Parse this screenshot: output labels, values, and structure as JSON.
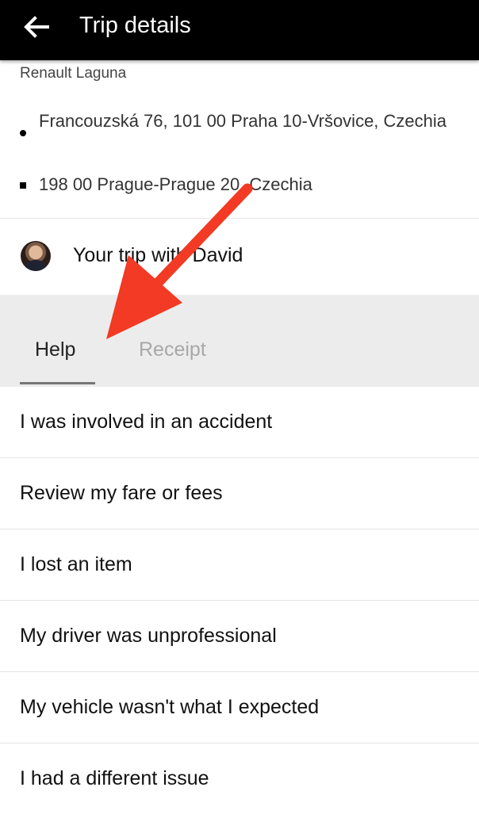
{
  "header": {
    "title": "Trip details",
    "back_icon": "back-arrow-icon"
  },
  "trip": {
    "vehicle": "Renault Laguna",
    "pickup": "Francouzská 76, 101 00 Praha 10-Vršovice, Czechia",
    "dropoff": "198 00 Prague-Prague 20, Czechia",
    "driver_label": "Your trip with David"
  },
  "tabs": [
    {
      "label": "Help",
      "active": true
    },
    {
      "label": "Receipt",
      "active": false
    }
  ],
  "help_items": [
    {
      "label": "I was involved in an accident"
    },
    {
      "label": "Review my fare or fees"
    },
    {
      "label": "I lost an item"
    },
    {
      "label": "My driver was unprofessional"
    },
    {
      "label": "My vehicle wasn't what I expected"
    },
    {
      "label": "I had a different issue"
    }
  ],
  "annotation": {
    "arrow_color": "#f23a24"
  }
}
